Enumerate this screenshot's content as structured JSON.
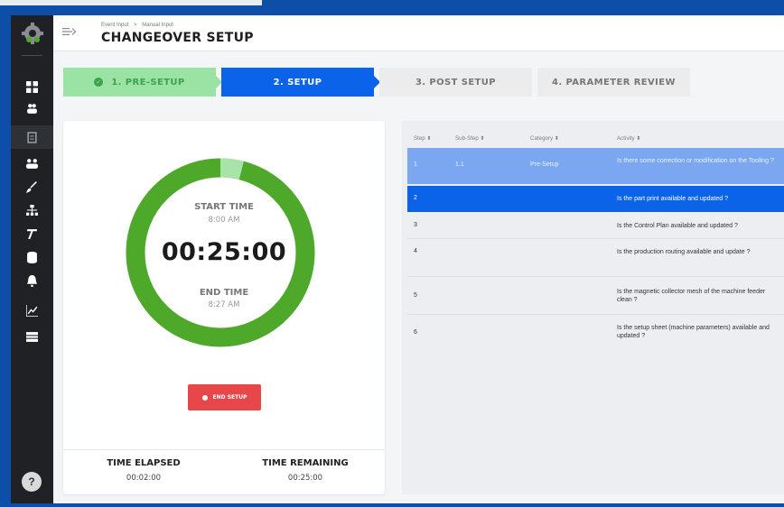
{
  "header": {
    "breadcrumb": [
      "Event Input",
      ">",
      "Manual Input"
    ],
    "title": "CHANGEOVER SETUP"
  },
  "stepper": [
    {
      "label": "1. PRE-SETUP",
      "state": "completed"
    },
    {
      "label": "2. SETUP",
      "state": "active"
    },
    {
      "label": "3. POST SETUP",
      "state": "pending"
    },
    {
      "label": "4. PARAMETER REVIEW",
      "state": "pending"
    }
  ],
  "sidebar": {
    "items": [
      {
        "icon": "dashboard-icon"
      },
      {
        "icon": "users-icon"
      },
      {
        "icon": "clipboard-icon",
        "active": true
      },
      {
        "icon": "group-icon"
      },
      {
        "icon": "brush-icon"
      },
      {
        "icon": "org-chart-icon"
      },
      {
        "icon": "tools-icon"
      },
      {
        "icon": "database-icon"
      },
      {
        "icon": "bell-icon"
      },
      {
        "icon": "chart-icon"
      },
      {
        "icon": "list-icon"
      }
    ],
    "help_label": "?"
  },
  "timer": {
    "start_label": "START TIME",
    "start_value": "8:00 AM",
    "countdown": "00:25:00",
    "end_label": "END TIME",
    "end_value": "8:27 AM",
    "progress_fraction": 0.04,
    "colors": {
      "ring": "#4ea92a",
      "ring_light": "#a8e3a8"
    },
    "end_button_label": "END SETUP",
    "elapsed_label": "TIME ELAPSED",
    "elapsed_value": "00:02:00",
    "remaining_label": "TIME REMAINING",
    "remaining_value": "00:25:00"
  },
  "table": {
    "columns": [
      "Step",
      "Sub-Step",
      "Category",
      "Activity"
    ],
    "rows": [
      {
        "step": "1",
        "sub_step": "1.1",
        "category": "Pre-Setup",
        "activity": "Is there some correction or modification on the Tooling ?",
        "state": "prev"
      },
      {
        "step": "2",
        "sub_step": "",
        "category": "",
        "activity": "Is the part print available and updated ?",
        "state": "current"
      },
      {
        "step": "3",
        "sub_step": "",
        "category": "",
        "activity": "Is the Control Plan available and updated ?",
        "state": ""
      },
      {
        "step": "4",
        "sub_step": "",
        "category": "",
        "activity": "Is the production routing  available and update ?",
        "state": ""
      },
      {
        "step": "5",
        "sub_step": "",
        "category": "",
        "activity": "Is the magnetic collector mesh of the machine feeder clean ?",
        "state": ""
      },
      {
        "step": "6",
        "sub_step": "",
        "category": "",
        "activity": "Is the setup sheet (machine parameters) available and updated ?",
        "state": ""
      }
    ]
  }
}
